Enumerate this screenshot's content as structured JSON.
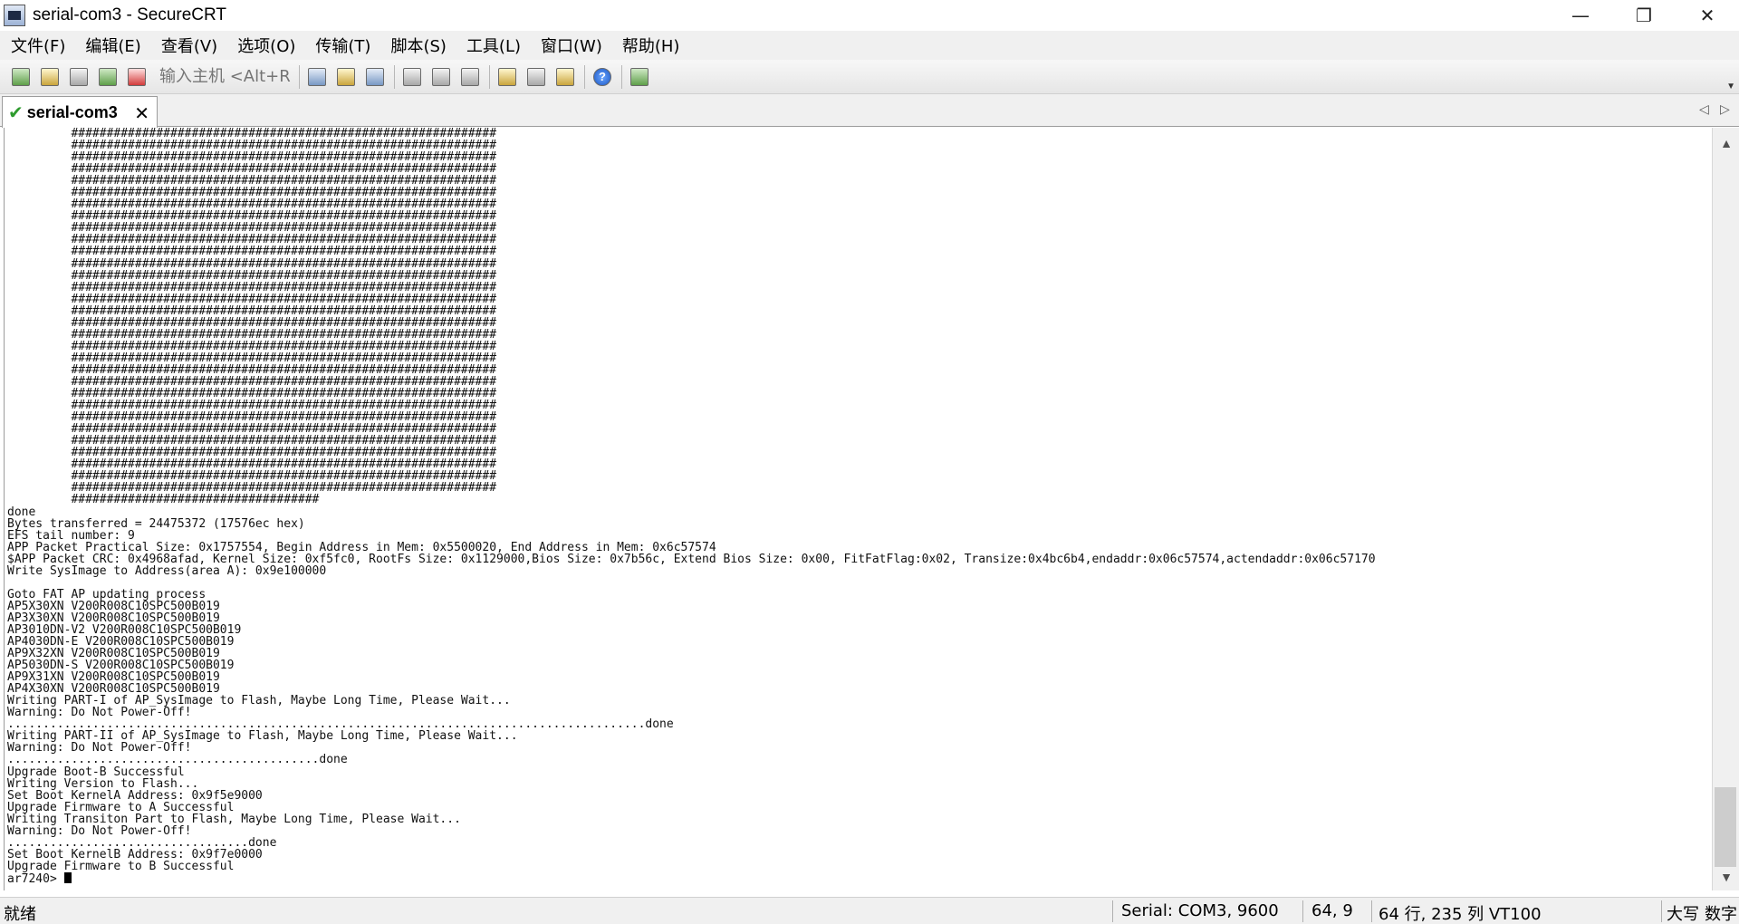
{
  "window": {
    "title": "serial-com3 - SecureCRT",
    "minimize": "—",
    "restore": "❐",
    "close": "✕"
  },
  "menu": [
    {
      "label": "文件(F)"
    },
    {
      "label": "编辑(E)"
    },
    {
      "label": "查看(V)"
    },
    {
      "label": "选项(O)"
    },
    {
      "label": "传输(T)"
    },
    {
      "label": "脚本(S)"
    },
    {
      "label": "工具(L)"
    },
    {
      "label": "窗口(W)"
    },
    {
      "label": "帮助(H)"
    }
  ],
  "toolbar": {
    "host_placeholder": "输入主机 <Alt+R>",
    "buttons": [
      "connect-icon",
      "quick-connect-icon",
      "connect-in-tab-icon",
      "reconnect-icon",
      "disconnect-icon",
      "copy-icon",
      "paste-icon",
      "find-icon",
      "print-screen-icon",
      "print-selection-icon",
      "print-icon",
      "session-options-icon",
      "global-options-icon",
      "keymap-icon",
      "help-icon",
      "screen-icon"
    ]
  },
  "tab": {
    "label": "serial-com3",
    "close": "✕"
  },
  "terminal": {
    "lines": [
      "         ############################################################",
      "         ############################################################",
      "         ############################################################",
      "         ############################################################",
      "         ############################################################",
      "         ############################################################",
      "         ############################################################",
      "         ############################################################",
      "         ############################################################",
      "         ############################################################",
      "         ############################################################",
      "         ############################################################",
      "         ############################################################",
      "         ############################################################",
      "         ############################################################",
      "         ############################################################",
      "         ############################################################",
      "         ############################################################",
      "         ############################################################",
      "         ############################################################",
      "         ############################################################",
      "         ############################################################",
      "         ############################################################",
      "         ############################################################",
      "         ############################################################",
      "         ############################################################",
      "         ############################################################",
      "         ############################################################",
      "         ############################################################",
      "         ############################################################",
      "         ############################################################",
      "         ###################################",
      "done",
      "Bytes transferred = 24475372 (17576ec hex)",
      "EFS tail number: 9",
      "APP Packet Practical Size: 0x1757554, Begin Address in Mem: 0x5500020, End Address in Mem: 0x6c57574",
      "$APP Packet CRC: 0x4968afad, Kernel Size: 0xf5fc0, RootFs Size: 0x1129000,Bios Size: 0x7b56c, Extend Bios Size: 0x00, FitFatFlag:0x02, Transize:0x4bc6b4,endaddr:0x06c57574,actendaddr:0x06c57170",
      "Write SysImage to Address(area A): 0x9e100000",
      "",
      "Goto FAT AP updating process",
      "AP5X30XN V200R008C10SPC500B019",
      "AP3X30XN V200R008C10SPC500B019",
      "AP3010DN-V2 V200R008C10SPC500B019",
      "AP4030DN-E V200R008C10SPC500B019",
      "AP9X32XN V200R008C10SPC500B019",
      "AP5030DN-S V200R008C10SPC500B019",
      "AP9X31XN V200R008C10SPC500B019",
      "AP4X30XN V200R008C10SPC500B019",
      "Writing PART-I of AP_SysImage to Flash, Maybe Long Time, Please Wait...",
      "Warning: Do Not Power-Off!",
      "..........................................................................................done",
      "Writing PART-II of AP_SysImage to Flash, Maybe Long Time, Please Wait...",
      "Warning: Do Not Power-Off!",
      "............................................done",
      "Upgrade Boot-B Successful",
      "Writing Version to Flash...",
      "Set Boot KernelA Address: 0x9f5e9000",
      "Upgrade Firmware to A Successful",
      "Writing Transiton Part to Flash, Maybe Long Time, Please Wait...",
      "Warning: Do Not Power-Off!",
      "..................................done",
      "Set Boot KernelB Address: 0x9f7e0000",
      "Upgrade Firmware to B Successful"
    ],
    "prompt": "ar7240> "
  },
  "scrollbar": {
    "up": "▲",
    "down": "▼"
  },
  "status": {
    "ready": "就绪",
    "connection": "Serial: COM3, 9600",
    "cursor_pos": "64,   9",
    "size": "64 行, 235 列 VT100",
    "caps": "大写",
    "num": "数字"
  }
}
